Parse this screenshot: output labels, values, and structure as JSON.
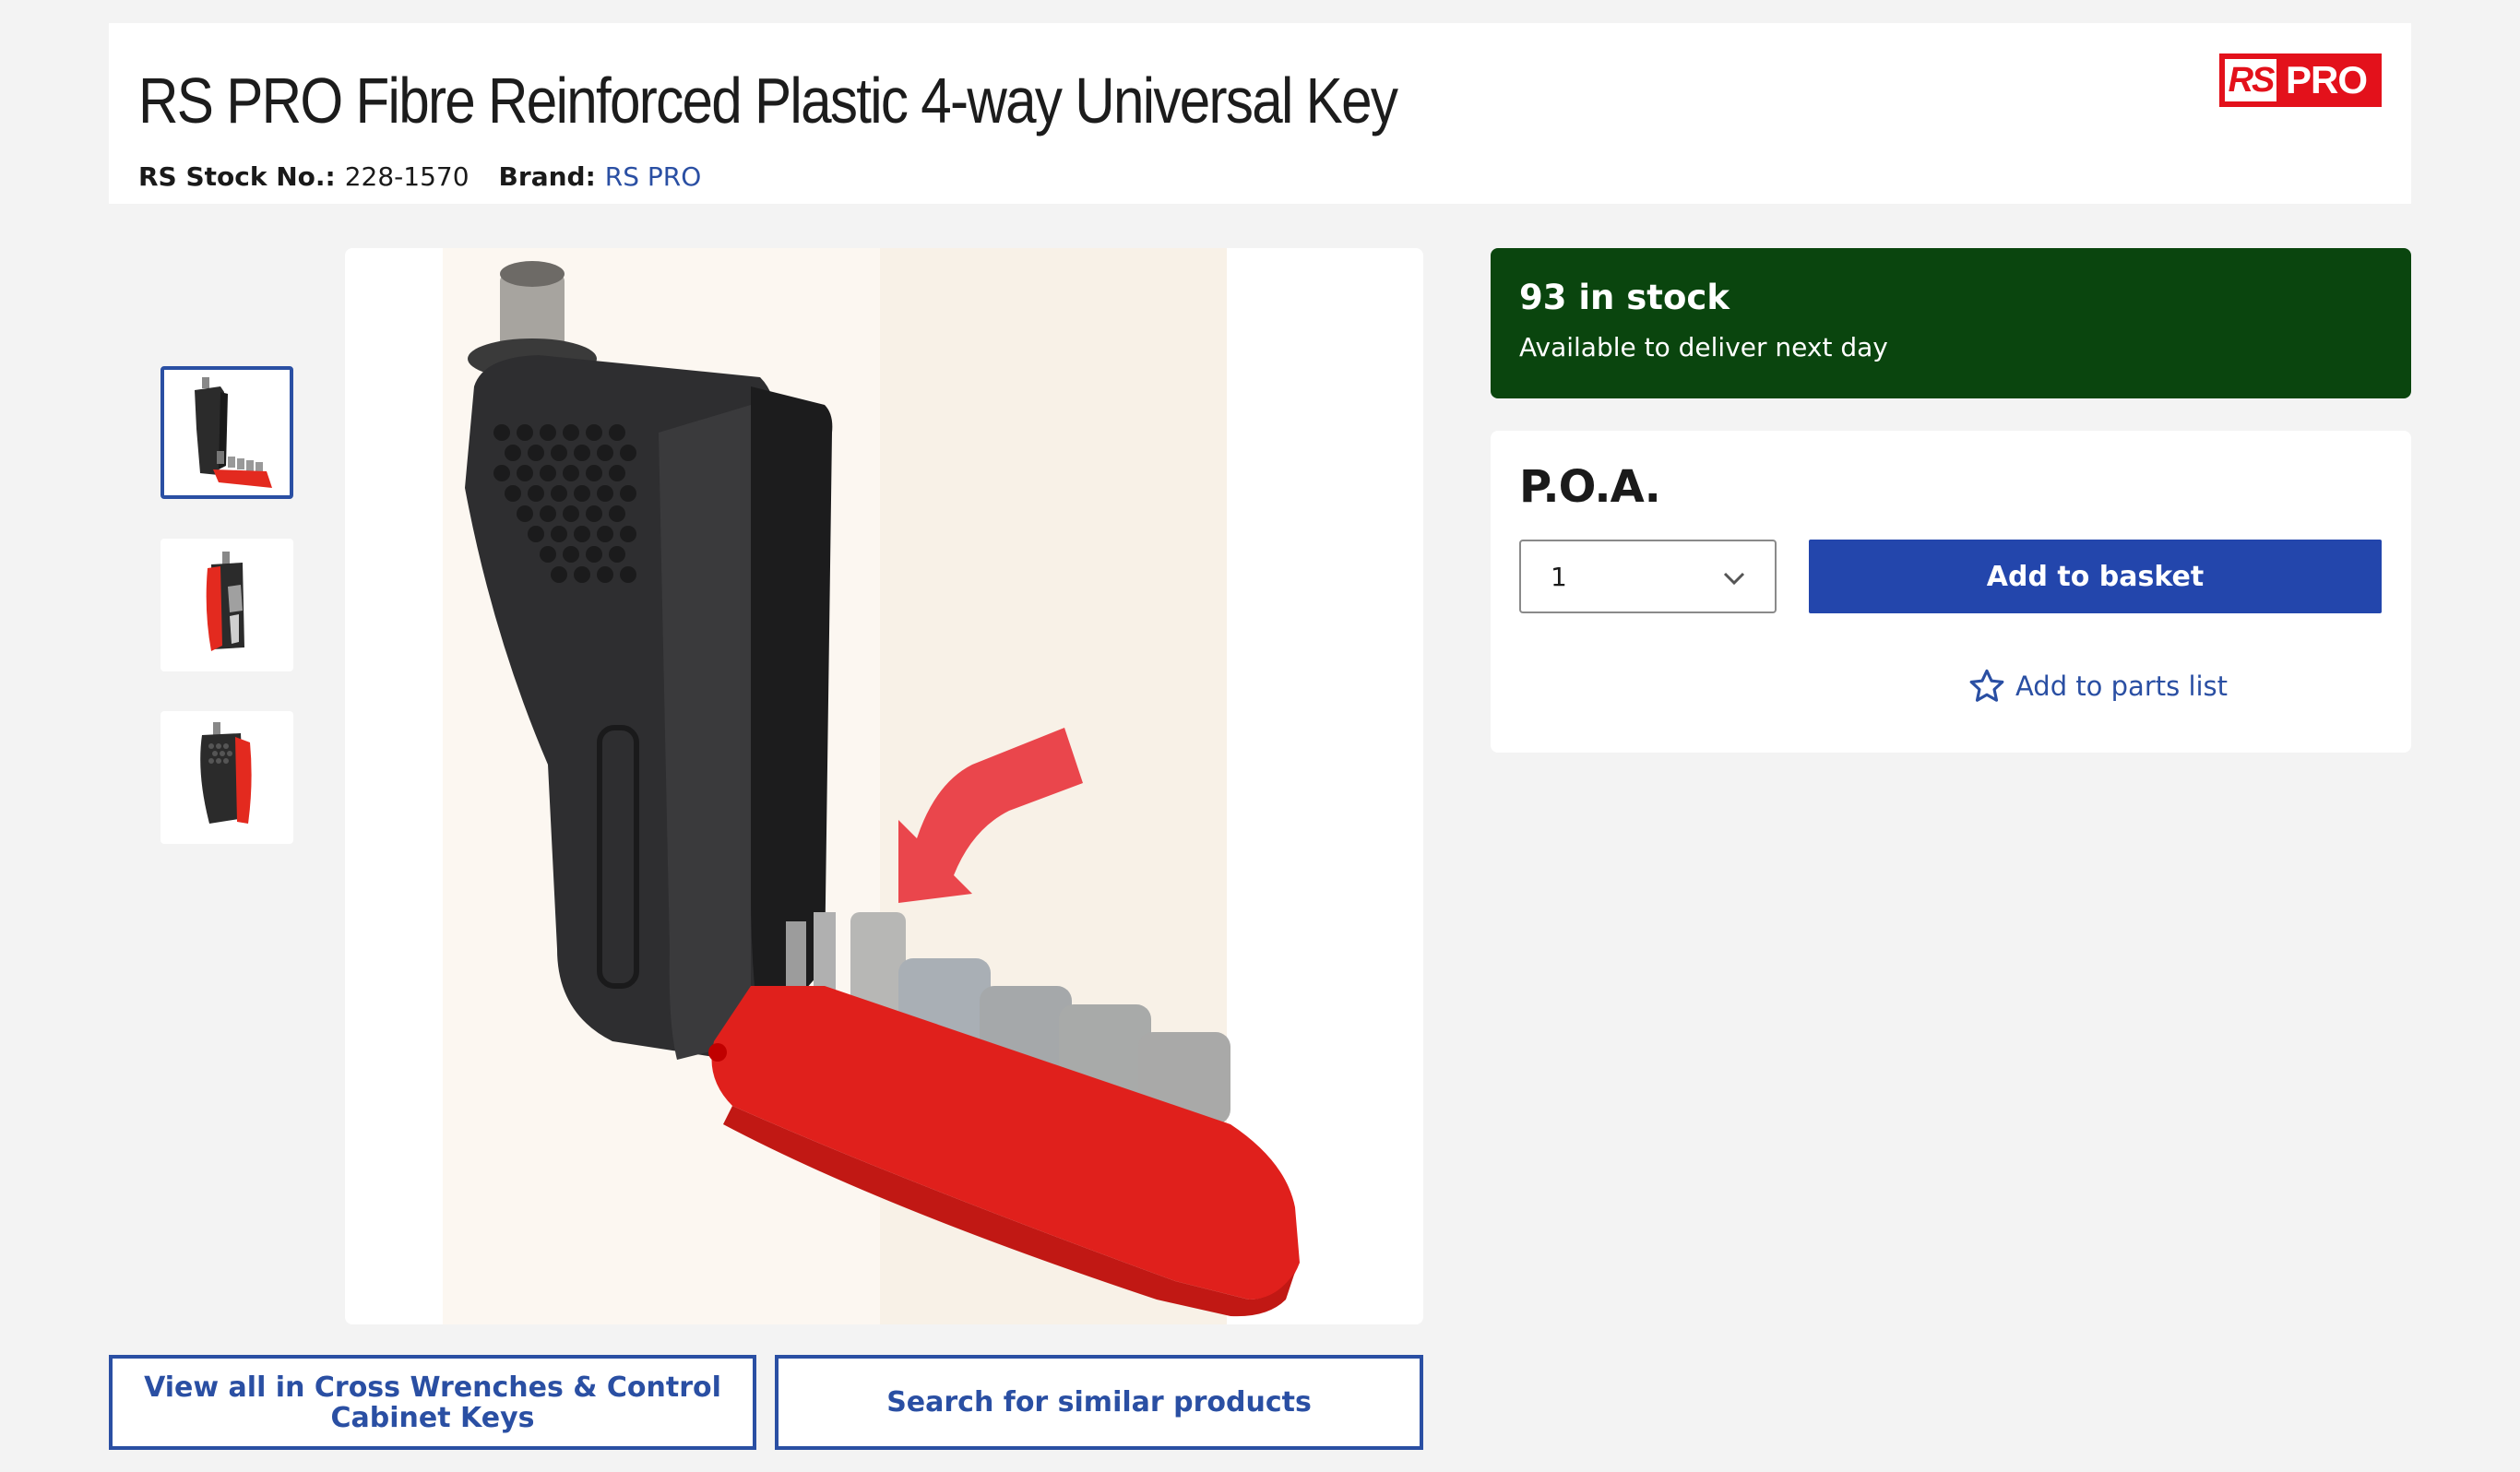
{
  "product": {
    "title": "RS PRO Fibre Reinforced Plastic 4-way Universal Key",
    "stock_no_label": "RS Stock No.:",
    "stock_no": "228-1570",
    "brand_label": "Brand:",
    "brand": "RS PRO"
  },
  "logo": {
    "rs_text": "RS",
    "pro_text": "PRO",
    "color": "#e3111b"
  },
  "gallery": {
    "thumbnails": [
      "thumbnail-1",
      "thumbnail-2",
      "thumbnail-3"
    ],
    "active_index": 0
  },
  "actions": {
    "view_all": "View all in Cross Wrenches & Control Cabinet Keys",
    "search_similar": "Search for similar products"
  },
  "stock": {
    "count_text": "93 in stock",
    "availability": "Available to deliver next day",
    "color": "#0a450e"
  },
  "pricing": {
    "price": "P.O.A.",
    "quantity": "1",
    "add_to_basket": "Add to basket",
    "add_to_parts_list": "Add to parts list",
    "accent": "#2346ac"
  },
  "icons": [
    "chevron-down-icon",
    "star-icon",
    "rs-pro-logo"
  ]
}
